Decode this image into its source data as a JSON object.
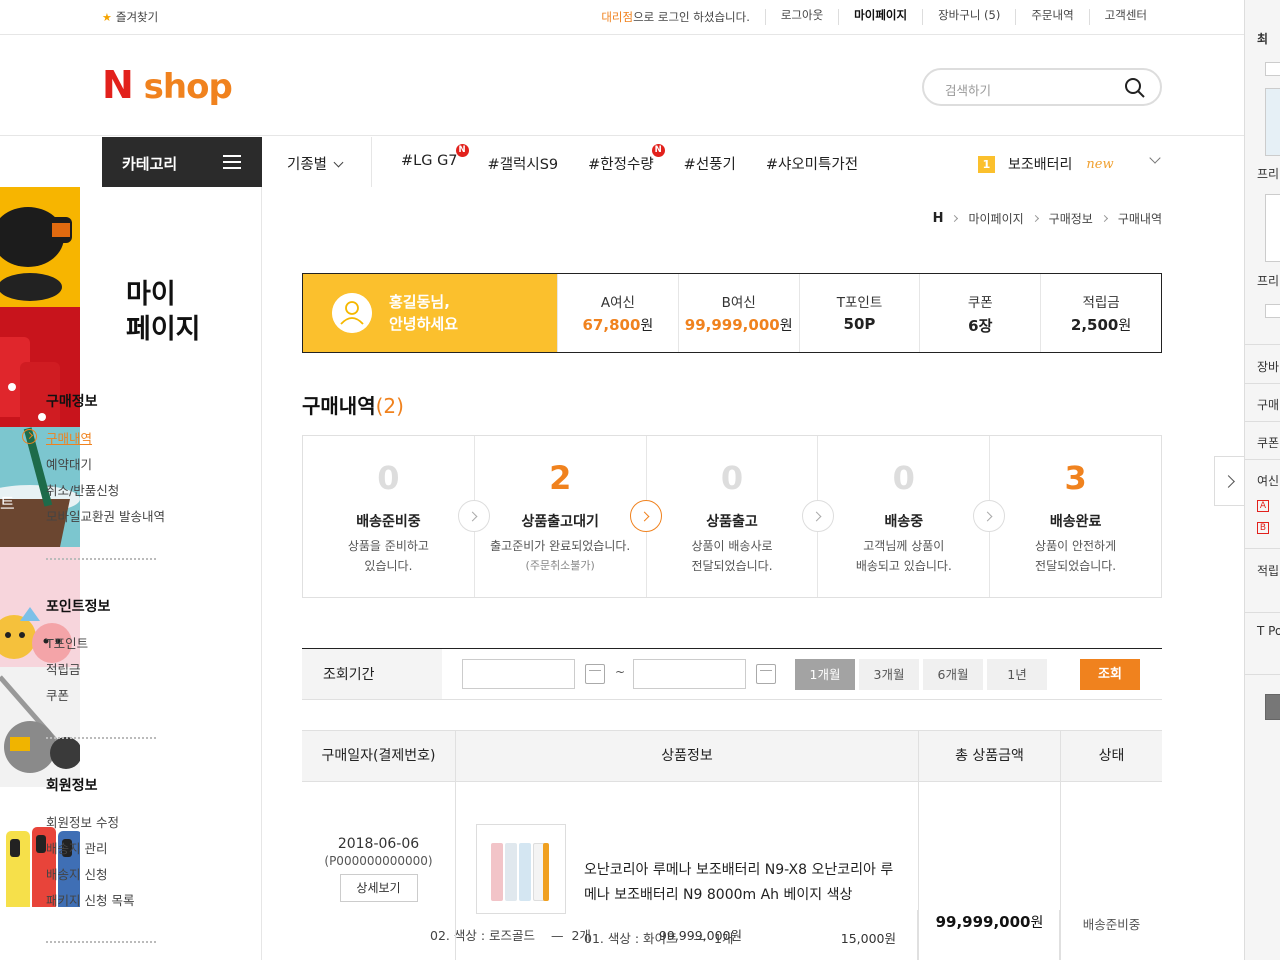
{
  "topbar": {
    "favorite": "즐겨찾기",
    "login_agent": "대리점",
    "login_suffix": "으로 로그인 하셨습니다.",
    "links": [
      "로그아웃",
      "마이페이지",
      "장바구니 (5)",
      "주문내역",
      "고객센터"
    ]
  },
  "header": {
    "logo_n": "N",
    "logo_shop": "shop",
    "search_placeholder": "검색하기"
  },
  "nav": {
    "category": "카테고리",
    "model": "기종별",
    "tags": [
      {
        "label": "#LG G7",
        "badge": "N"
      },
      {
        "label": "#갤럭시S9",
        "badge": ""
      },
      {
        "label": "#한정수량",
        "badge": "N"
      },
      {
        "label": "#선풍기",
        "badge": ""
      },
      {
        "label": "#샤오미특가전",
        "badge": ""
      }
    ],
    "rank_num": "1",
    "rank_item": "보조배터리",
    "rank_new": "new"
  },
  "sidebar": {
    "title_line1": "마이",
    "title_line2": "페이지",
    "groups": [
      {
        "heading": "구매정보",
        "items": [
          "구매내역",
          "예약대기",
          "취소/반품신청",
          "모바일교환권 발송내역"
        ]
      },
      {
        "heading": "포인트정보",
        "items": [
          "T포인트",
          "적립금",
          "쿠폰"
        ]
      },
      {
        "heading": "회원정보",
        "items": [
          "회원정보 수정",
          "배송지 관리",
          "배송지 신청",
          "패키지 신청 목록"
        ]
      }
    ]
  },
  "breadcrumb": [
    "H",
    "마이페이지",
    "구매정보",
    "구매내역"
  ],
  "summary": {
    "greeting_line1": "홍길동님,",
    "greeting_line2": "안녕하세요",
    "cells": [
      {
        "label": "A여신",
        "value": "67,800",
        "unit": "원",
        "accent": true
      },
      {
        "label": "B여신",
        "value": "99,999,000",
        "unit": "원",
        "accent": true
      },
      {
        "label": "T포인트",
        "value": "50P",
        "unit": "",
        "accent": false
      },
      {
        "label": "쿠폰",
        "value": "6장",
        "unit": "",
        "accent": false
      },
      {
        "label": "적립금",
        "value": "2,500",
        "unit": "원",
        "accent": false
      }
    ]
  },
  "section": {
    "title": "구매내역",
    "count": "2"
  },
  "steps": [
    {
      "count": "0",
      "name": "배송준비중",
      "desc1": "상품을 준비하고",
      "desc2": "있습니다.",
      "sub": "",
      "active": false
    },
    {
      "count": "2",
      "name": "상품출고대기",
      "desc1": "출고준비가 완료되었습니다.",
      "desc2": "",
      "sub": "(주문취소불가)",
      "active": true
    },
    {
      "count": "0",
      "name": "상품출고",
      "desc1": "상품이 배송사로",
      "desc2": "전달되었습니다.",
      "sub": "",
      "active": false
    },
    {
      "count": "0",
      "name": "배송중",
      "desc1": "고객님께 상품이",
      "desc2": "배송되고 있습니다.",
      "sub": "",
      "active": false
    },
    {
      "count": "3",
      "name": "배송완료",
      "desc1": "상품이 안전하게",
      "desc2": "전달되었습니다.",
      "sub": "",
      "active": true
    }
  ],
  "filter": {
    "label": "조회기간",
    "tilde": "~",
    "periods": [
      "1개월",
      "3개월",
      "6개월",
      "1년"
    ],
    "selected_period": "1개월",
    "search": "조회"
  },
  "table": {
    "headers": [
      "구매일자(결제번호)",
      "상품정보",
      "총 상품금액",
      "상태"
    ],
    "rows": [
      {
        "date": "2018-06-06",
        "payment_no": "(P000000000000)",
        "detail_btn": "상세보기",
        "product": "오난코리아 루메나 보조배터리 N9-X8 오난코리아 루메나 보조배터리 N9 8000m Ah 베이지 색상",
        "options": [
          {
            "label": "01. 색상 : 화이트",
            "qty": "1개",
            "price": "15,000원"
          },
          {
            "label": "02. 색상 : 로즈골드",
            "qty": "2개",
            "price": "99,999,000원"
          }
        ],
        "total": "99,999,000",
        "total_unit": "원",
        "status": "배송준비중"
      }
    ]
  },
  "quick_panel": {
    "labels": [
      "최",
      "프리",
      "프리",
      "장바",
      "구매",
      "쿠폰",
      "여신",
      "적립",
      "T Po"
    ],
    "credit_marks": [
      "A",
      "B"
    ]
  }
}
